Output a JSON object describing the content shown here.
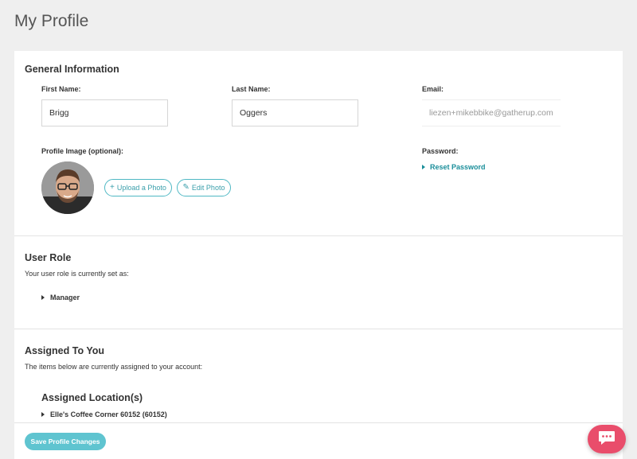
{
  "page": {
    "title": "My Profile"
  },
  "general": {
    "title": "General Information",
    "first_name_label": "First Name:",
    "first_name_value": "Brigg",
    "last_name_label": "Last Name:",
    "last_name_value": "Oggers",
    "email_label": "Email:",
    "email_value": "liezen+mikebbike@gatherup.com",
    "profile_image_label": "Profile Image (optional):",
    "upload_label": "Upload a Photo",
    "edit_label": "Edit Photo",
    "password_label": "Password:",
    "reset_password_label": "Reset Password"
  },
  "user_role": {
    "title": "User Role",
    "description": "Your user role is currently set as:",
    "role": "Manager"
  },
  "assigned": {
    "title": "Assigned To You",
    "description": "The items below are currently assigned to your account:",
    "locations_heading": "Assigned Location(s)",
    "locations": [
      "Elle's Coffee Corner 60152 (60152)"
    ]
  },
  "footer": {
    "save_label": "Save Profile Changes"
  },
  "icons": {
    "upload": "plus-icon",
    "edit": "pencil-icon",
    "caret": "caret-right-icon",
    "chat": "chat-bubble-icon"
  },
  "colors": {
    "accent": "#3a9fab",
    "link": "#1a8e9a",
    "save_button": "#5fc4d0",
    "chat_button": "#e94d6b"
  }
}
